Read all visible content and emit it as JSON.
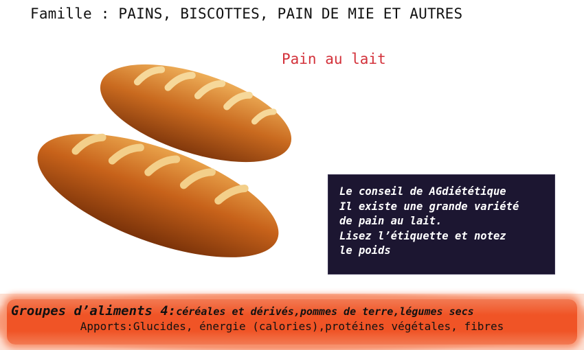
{
  "header": {
    "family": "Famille : PAINS, BISCOTTES, PAIN DE MIE ET AUTRES"
  },
  "product": {
    "name": "Pain au lait"
  },
  "tip": {
    "lines": [
      "Le conseil de AGdiététique",
      "Il existe une grande variété",
      "de pain au lait.",
      "Lisez l’étiquette et notez",
      "le poids"
    ]
  },
  "footer": {
    "group_label": "Groupes d’aliments 4:",
    "group_items": "céréales et dérivés,pommes de terre,légumes secs",
    "contributions": "Apports:Glucides, énergie (calories),protéines végétales, fibres"
  },
  "colors": {
    "title": "#d3313a",
    "tip_background": "#1c1631",
    "footer_band": "#f05426"
  }
}
